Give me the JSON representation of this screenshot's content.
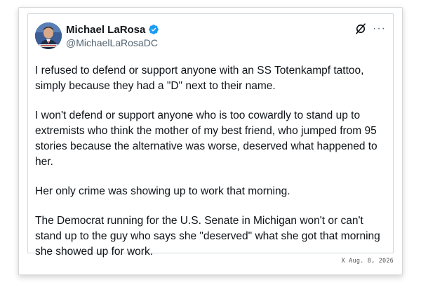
{
  "author": {
    "display_name": "Michael LaRosa",
    "handle": "@MichaelLaRosaDC",
    "verified": true,
    "avatar_icon": "avatar-photo"
  },
  "actions": {
    "grok_icon": "grok-slash-icon",
    "more_icon": "more-horizontal-icon",
    "more_label": "···"
  },
  "tweet": {
    "paragraphs": [
      "I refused to defend or support anyone with an SS Totenkampf tattoo, simply because they had a \"D\" next to their name.",
      "I won't defend or support anyone who is too cowardly to stand up to extremists who think the mother of my best friend, who jumped from 95 stories because the alternative was worse, deserved what happened to her.",
      "Her only crime was showing up to work that morning.",
      "The Democrat running for the U.S. Senate in Michigan won't or can't stand up to the guy who says she \"deserved\" what she got that morning she showed up for work."
    ]
  },
  "footer": {
    "date_stamp": "X  Aug. 8, 2026"
  },
  "colors": {
    "verified_blue": "#1d9bf0",
    "handle_gray": "#536471",
    "text": "#0f1419",
    "card_border": "#cfd9de"
  }
}
